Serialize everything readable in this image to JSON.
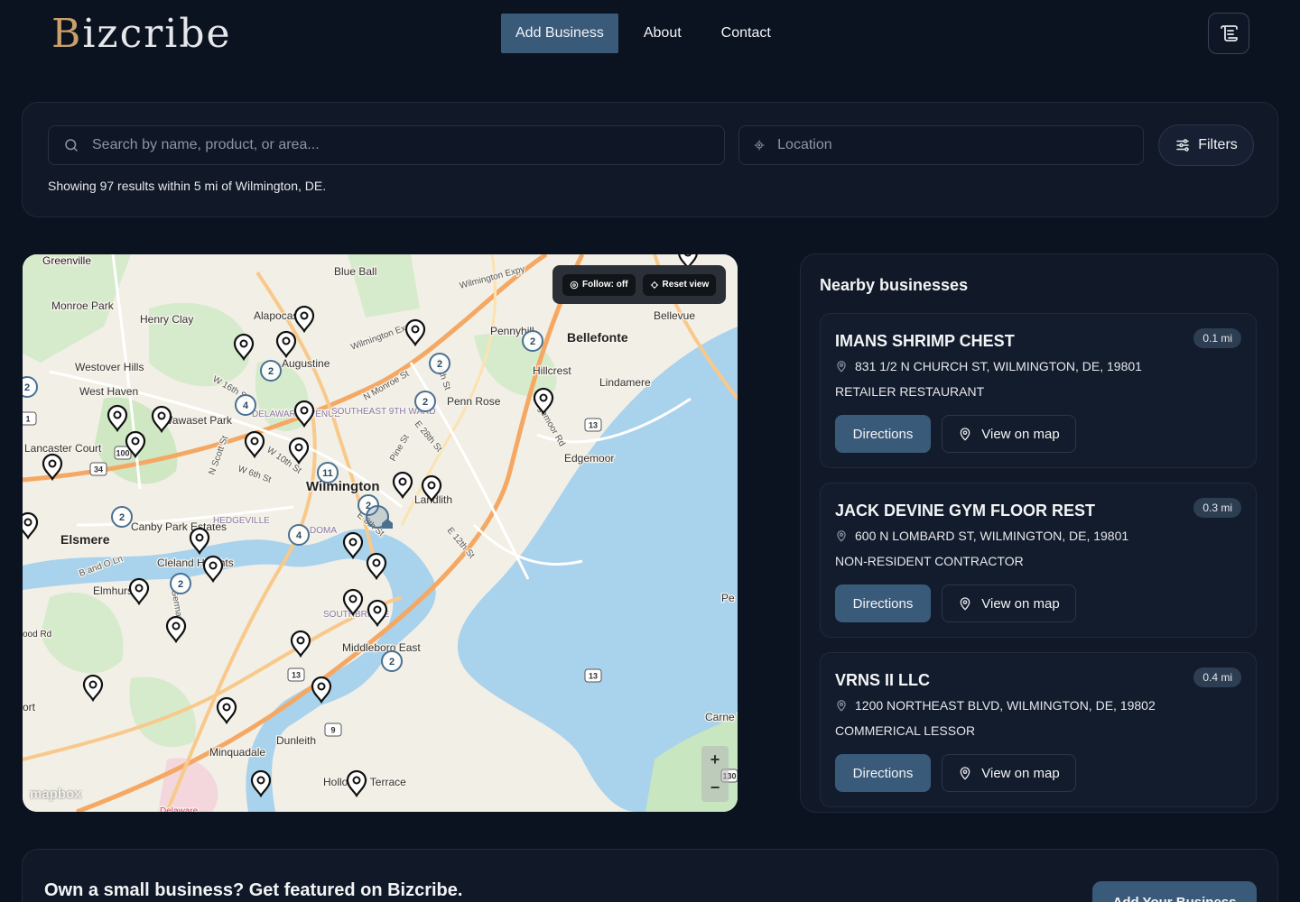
{
  "brand": {
    "first_letter": "B",
    "rest": "izcribe"
  },
  "nav": {
    "add_business": "Add Business",
    "about": "About",
    "contact": "Contact"
  },
  "search": {
    "placeholder": "Search by name, product, or area...",
    "location_placeholder": "Location",
    "filters_label": "Filters",
    "results_text": "Showing 97 results within 5 mi of Wilmington, DE."
  },
  "map": {
    "follow_label": "Follow: off",
    "reset_label": "Reset view",
    "zoom_in": "+",
    "zoom_out": "−",
    "attribution": "mapbox",
    "place_labels": [
      "Greenville",
      "Blue Ball",
      "Monroe Park",
      "Henry Clay",
      "Alapocas",
      "Pennyhill",
      "Bellefonte",
      "Bellevue",
      "Augustine",
      "Westover Hills",
      "Hillcrest",
      "Lindamere",
      "West Haven",
      "Penn Rose",
      "Wawaset Park",
      "DELAWARE AVENUE",
      "SOUTHEAST 9TH WARD",
      "Lancaster Court",
      "Edgemoor",
      "Wilmington",
      "Landlith",
      "Elsmere",
      "Canby Park Estates",
      "HEDGEVILLE",
      "Cleland Heights",
      "Elmhurst",
      "SOUTHBRIDGE",
      "Middleboro East",
      "Dunleith",
      "Minquadale",
      "Holloway Terrace",
      "Wilmington Expy",
      "Wilmington Expy",
      "W 16th St",
      "N Monroe St",
      "N Scott St",
      "W 10th St",
      "W 6th St",
      "E 28th St",
      "Pine St",
      "E 12th St",
      "Carne Tow",
      "Pe",
      "ort",
      "ood Rd",
      "B and O Ln",
      "Germay",
      "Delaware",
      "Edgemoor Rd",
      "E 8th St",
      "DOMA",
      "N 4th St"
    ],
    "shield_labels": [
      "13",
      "34",
      "100",
      "13",
      "9",
      "13",
      "130",
      "1"
    ],
    "cluster_counts": [
      "2",
      "2",
      "2",
      "2",
      "4",
      "2",
      "2",
      "11",
      "2",
      "2",
      "4",
      "2"
    ]
  },
  "nearby": {
    "title": "Nearby businesses",
    "directions_label": "Directions",
    "view_map_label": "View on map",
    "items": [
      {
        "name": "IMANS SHRIMP CHEST",
        "distance": "0.1 mi",
        "address": "831 1/2 N CHURCH ST, WILMINGTON, DE, 19801",
        "category": "RETAILER RESTAURANT"
      },
      {
        "name": "JACK DEVINE GYM FLOOR REST",
        "distance": "0.3 mi",
        "address": "600 N LOMBARD ST, WILMINGTON, DE, 19801",
        "category": "NON-RESIDENT CONTRACTOR"
      },
      {
        "name": "VRNS II LLC",
        "distance": "0.4 mi",
        "address": "1200 NORTHEAST BLVD, WILMINGTON, DE, 19802",
        "category": "COMMERICAL LESSOR"
      }
    ]
  },
  "cta": {
    "text": "Own a small business? Get featured on Bizcribe.",
    "button": "Add Your Business"
  },
  "colors": {
    "accent": "#3a5a7a",
    "background": "#0b1220",
    "panel": "#111827",
    "brand_gold": "#c9a06a",
    "water": "#a9d2ec",
    "park": "#c8e6c0"
  }
}
